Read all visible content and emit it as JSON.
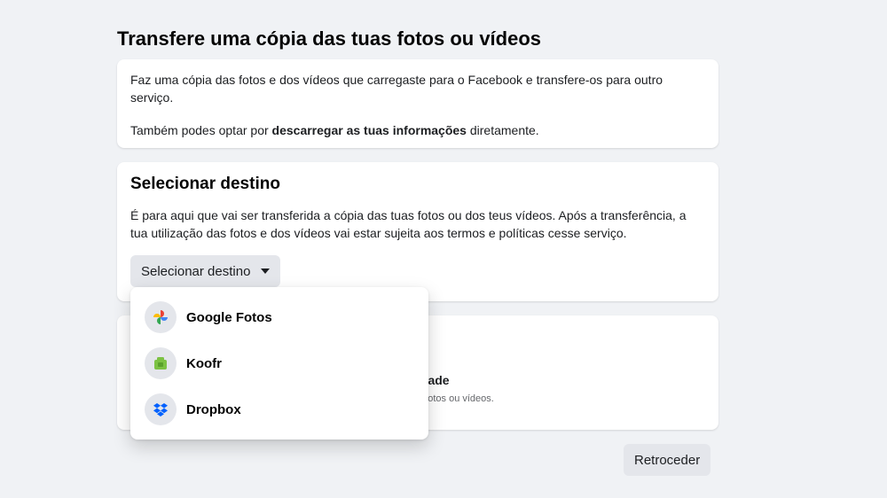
{
  "page": {
    "title": "Transfere uma cópia das tuas fotos ou vídeos"
  },
  "intro": {
    "line1": "Faz uma cópia das fotos e dos vídeos que carregaste para o Facebook e transfere-os para outro serviço.",
    "line2_prefix": "Também podes optar por ",
    "line2_link": "descarregar as tuas informações",
    "line2_suffix": " diretamente."
  },
  "destination": {
    "title": "Selecionar destino",
    "description": "É para aqui que vai ser transferida a cópia das tuas fotos ou dos teus vídeos. Após a transferência, a tua utilização das fotos e dos vídeos vai estar sujeita aos termos e políticas cesse serviço.",
    "button_label": "Selecionar destino",
    "options": [
      {
        "label": "Google Fotos",
        "icon": "google-photos-icon"
      },
      {
        "label": "Koofr",
        "icon": "koofr-icon"
      },
      {
        "label": "Dropbox",
        "icon": "dropbox-icon"
      }
    ]
  },
  "third_card": {
    "partial_label": "idade",
    "partial_desc": "e fotos ou vídeos."
  },
  "footer": {
    "back_label": "Retroceder"
  },
  "colors": {
    "background": "#f0f2f5",
    "card": "#ffffff",
    "button": "#e4e6eb",
    "text": "#1c1e21",
    "koofr_green": "#7cc243",
    "dropbox_blue": "#0061fe"
  }
}
